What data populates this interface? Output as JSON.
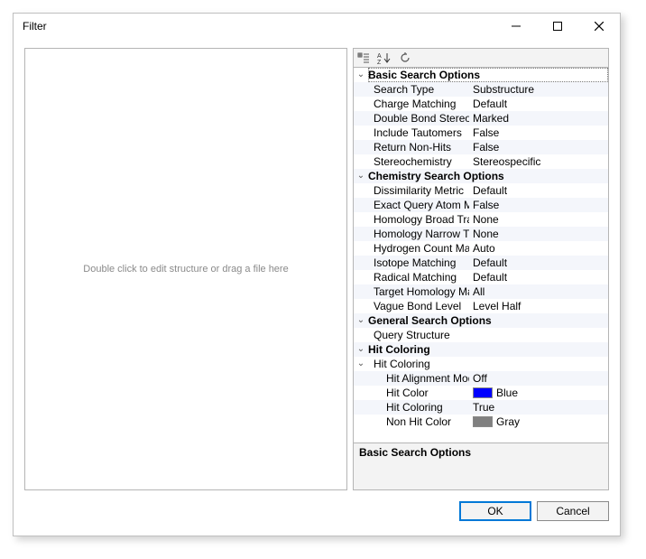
{
  "window": {
    "title": "Filter",
    "ok_label": "OK",
    "cancel_label": "Cancel"
  },
  "left_pane": {
    "hint": "Double click to edit structure or drag a file here"
  },
  "property_grid": {
    "help_title": "Basic Search Options",
    "categories": [
      {
        "name": "Basic Search Options",
        "expanded": true,
        "selected": true,
        "props": [
          {
            "name": "Search Type",
            "value": "Substructure"
          },
          {
            "name": "Charge Matching",
            "value": "Default"
          },
          {
            "name": "Double Bond Stereo Chemistry",
            "value": "Marked"
          },
          {
            "name": "Include Tautomers",
            "value": "False"
          },
          {
            "name": "Return Non-Hits",
            "value": "False"
          },
          {
            "name": "Stereochemistry",
            "value": "Stereospecific"
          }
        ]
      },
      {
        "name": "Chemistry Search Options",
        "expanded": true,
        "props": [
          {
            "name": "Dissimilarity Metric",
            "value": "Default"
          },
          {
            "name": "Exact Query Atom Matching",
            "value": "False"
          },
          {
            "name": "Homology Broad Translation",
            "value": "None"
          },
          {
            "name": "Homology Narrow Translation",
            "value": "None"
          },
          {
            "name": "Hydrogen Count Matching",
            "value": "Auto"
          },
          {
            "name": "Isotope Matching",
            "value": "Default"
          },
          {
            "name": "Radical Matching",
            "value": "Default"
          },
          {
            "name": "Target Homology Matching",
            "value": "All"
          },
          {
            "name": "Vague Bond Level",
            "value": "Level Half"
          }
        ]
      },
      {
        "name": "General Search Options",
        "expanded": true,
        "props": [
          {
            "name": "Query Structure",
            "value": ""
          }
        ]
      },
      {
        "name": "Hit Coloring",
        "expanded": true,
        "subgroups": [
          {
            "name": "Hit Coloring",
            "expanded": true,
            "props": [
              {
                "name": "Hit Alignment Mode",
                "value": "Off"
              },
              {
                "name": "Hit Color",
                "value": "Blue",
                "swatch": "#0000ff"
              },
              {
                "name": "Hit Coloring",
                "value": "True"
              },
              {
                "name": "Non Hit Color",
                "value": "Gray",
                "swatch": "#808080"
              }
            ]
          }
        ]
      }
    ]
  }
}
